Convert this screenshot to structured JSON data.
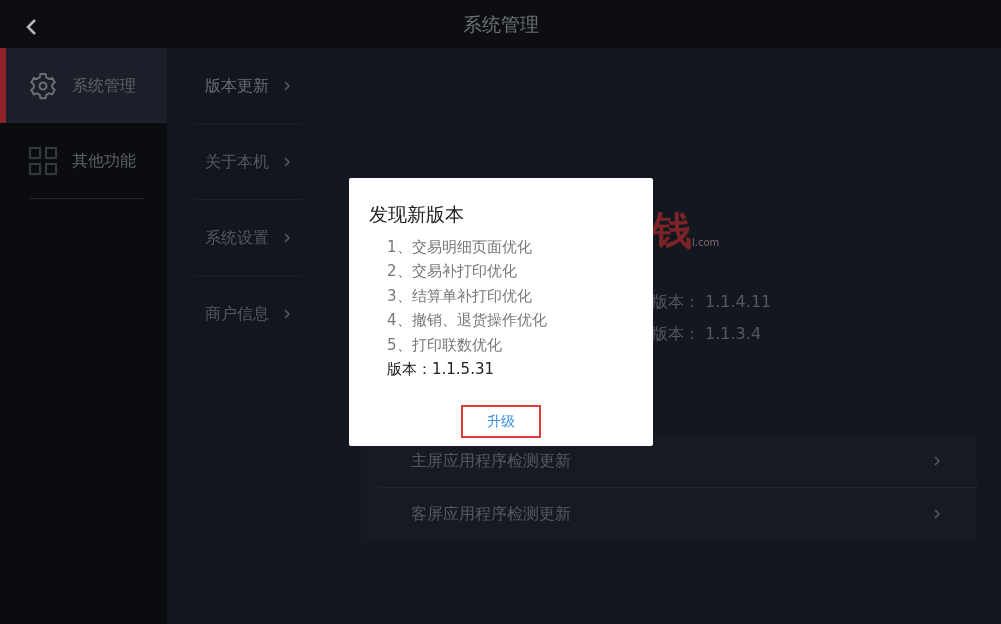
{
  "header": {
    "title": "系统管理"
  },
  "sidebar": {
    "items": [
      {
        "label": "系统管理",
        "kind": "gear",
        "selected": true
      },
      {
        "label": "其他功能",
        "kind": "grid",
        "selected": false
      }
    ]
  },
  "submenu": {
    "items": [
      {
        "label": "版本更新",
        "selected": true
      },
      {
        "label": "关于本机",
        "selected": false
      },
      {
        "label": "系统设置",
        "selected": false
      },
      {
        "label": "商户信息",
        "selected": false
      }
    ]
  },
  "main": {
    "logo": {
      "text": "钱",
      "tagline": "l.com"
    },
    "versions": [
      "版本： 1.1.4.11",
      "版本： 1.1.3.4"
    ],
    "update_rows": [
      "主屏应用程序检测更新",
      "客屏应用程序检测更新"
    ]
  },
  "dialog": {
    "title": "发现新版本",
    "notes": [
      "1、交易明细页面优化",
      "2、交易补打印优化",
      "3、结算单补打印优化",
      "4、撤销、退货操作优化",
      "5、打印联数优化"
    ],
    "version": "版本：1.1.5.31",
    "button": "升级"
  }
}
